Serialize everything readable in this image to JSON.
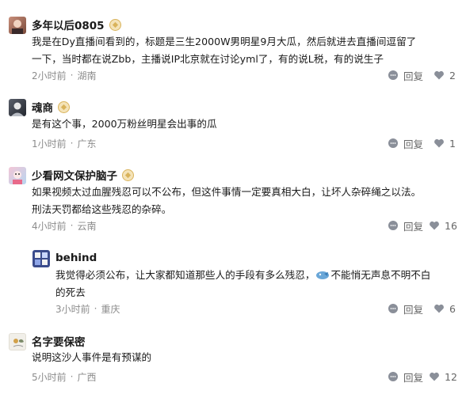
{
  "comments": [
    {
      "username": "多年以后0805",
      "text_lines": [
        "我是在Dy直播间看到的，标题是三生2000W男明星9月大瓜，然后就进去直播间逗留了",
        "一下，当时都在说Zbb，主播说IP北京就在讨论yml了，有的说L税，有的说生子"
      ],
      "time": "2小时前",
      "location": "湖南",
      "reply_label": "回复",
      "likes": "2"
    },
    {
      "username": "魂商",
      "text_lines": [
        "是有这个事，2000万粉丝明星会出事的瓜"
      ],
      "time": "1小时前",
      "location": "广东",
      "reply_label": "回复",
      "likes": "1"
    },
    {
      "username": "少看网文保护脑子",
      "text_lines": [
        "如果视频太过血腥残忍可以不公布，但这件事情一定要真相大白，让坏人杂碎绳之以法。",
        "刑法天罚都给这些残忍的杂碎。"
      ],
      "time": "4小时前",
      "location": "云南",
      "reply_label": "回复",
      "likes": "16"
    },
    {
      "username": "behind",
      "text_lines_1a": "我觉得必须公布，让大家都知道那些人的手段有多么残忍，",
      "text_lines_1b": "不能悄无声息不明不白",
      "text_line_2": "的死去",
      "time": "3小时前",
      "location": "重庆",
      "reply_label": "回复",
      "likes": "6"
    },
    {
      "username": "名字要保密",
      "text_lines": [
        "说明这沙人事件是有预谋的"
      ],
      "time": "5小时前",
      "location": "广西",
      "reply_label": "回复",
      "likes": "12"
    }
  ],
  "colors": {
    "text": "#1a1a1a",
    "meta": "#8c8c8c",
    "badge": "#d9b35b"
  }
}
